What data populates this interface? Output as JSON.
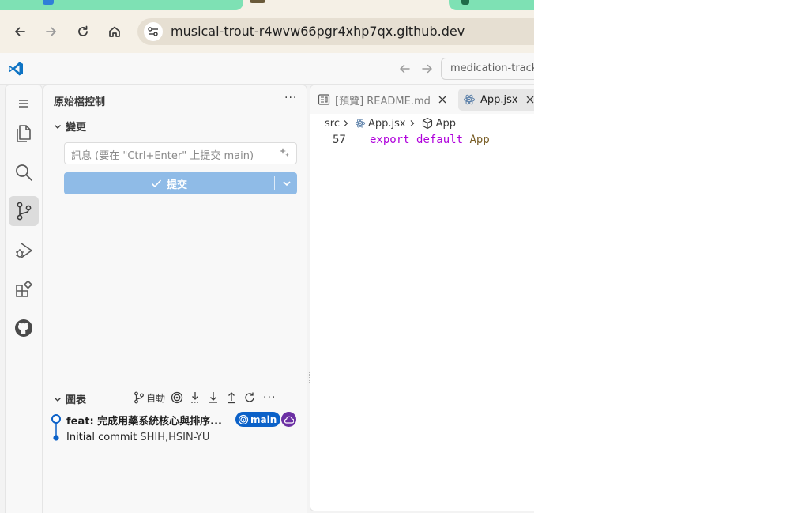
{
  "browser": {
    "url": "musical-trout-r4wvw66pgr4xhp7qx.github.dev"
  },
  "titlebar": {
    "command_center": "medication-tracke"
  },
  "sidebar": {
    "title": "原始檔控制",
    "more": "···",
    "changes_section": "變更",
    "message_placeholder": "訊息 (要在 \"Ctrl+Enter\" 上提交 main)",
    "commit_label": "提交",
    "graph_section": "圖表",
    "graph_auto_label": "自動",
    "graph_more": "···",
    "commits": [
      {
        "message": "feat: 完成用藥系統核心與排序...",
        "branch": "main"
      },
      {
        "message": "Initial commit",
        "author": "SHIH,HSIN-YU"
      }
    ]
  },
  "editor": {
    "tabs": [
      {
        "label": "[預覽] README.md",
        "active": false
      },
      {
        "label": "App.jsx",
        "active": true
      }
    ],
    "breadcrumb": [
      "src",
      "App.jsx",
      "App"
    ],
    "lines": [
      {
        "number": "57",
        "keyword1": "export",
        "keyword2": "default",
        "identifier": "App"
      }
    ]
  },
  "colors": {
    "accent": "#0b61c8",
    "commit_button": "#8fbbe7",
    "keyword": "#af00db",
    "tab_green": "#7ee1b4"
  }
}
